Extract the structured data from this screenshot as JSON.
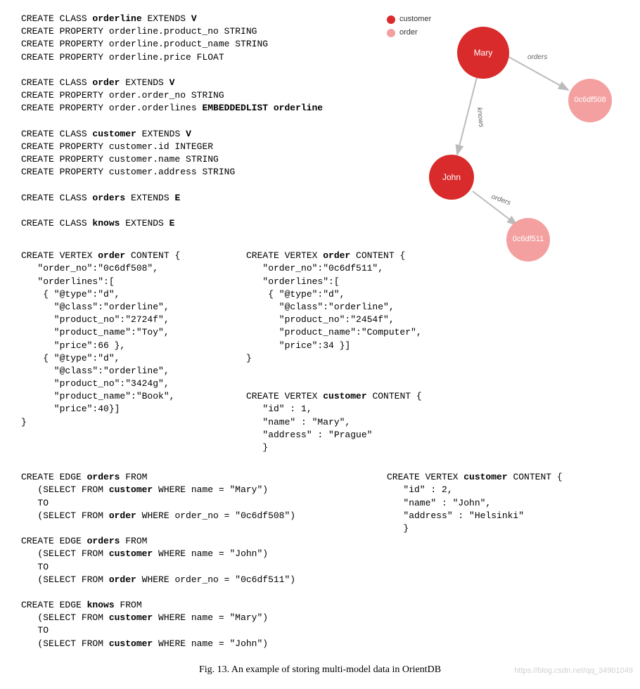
{
  "legend": {
    "customer": "customer",
    "order": "order"
  },
  "nodes": {
    "mary": "Mary",
    "john": "John",
    "o1": "0c6df508",
    "o2": "0c6df511"
  },
  "edges": {
    "orders": "orders",
    "knows": "knows"
  },
  "schema": {
    "l1a": "CREATE CLASS ",
    "l1b": "orderline",
    "l1c": " EXTENDS ",
    "l1d": "V",
    "l2": "CREATE PROPERTY orderline.product_no STRING",
    "l3": "CREATE PROPERTY orderline.product_name STRING",
    "l4": "CREATE PROPERTY orderline.price FLOAT",
    "l5a": "CREATE CLASS ",
    "l5b": "order",
    "l5c": " EXTENDS ",
    "l5d": "V",
    "l6": "CREATE PROPERTY order.order_no STRING",
    "l7a": "CREATE PROPERTY order.orderlines ",
    "l7b": "EMBEDDEDLIST orderline",
    "l8a": "CREATE CLASS ",
    "l8b": "customer",
    "l8c": " EXTENDS ",
    "l8d": "V",
    "l9": "CREATE PROPERTY customer.id INTEGER",
    "l10": "CREATE PROPERTY customer.name STRING",
    "l11": "CREATE PROPERTY customer.address STRING",
    "l12a": "CREATE CLASS ",
    "l12b": "orders",
    "l12c": " EXTENDS ",
    "l12d": "E",
    "l13a": "CREATE CLASS ",
    "l13b": "knows",
    "l13c": " EXTENDS ",
    "l13d": "E"
  },
  "vertex1": {
    "l1a": "CREATE VERTEX ",
    "l1b": "order",
    "l1c": " CONTENT {",
    "l2": "   \"order_no\":\"0c6df508\",",
    "l3": "   \"orderlines\":[",
    "l4": "    { \"@type\":\"d\",",
    "l5": "      \"@class\":\"orderline\",",
    "l6": "      \"product_no\":\"2724f\",",
    "l7": "      \"product_name\":\"Toy\",",
    "l8": "      \"price\":66 },",
    "l9": "    { \"@type\":\"d\",",
    "l10": "      \"@class\":\"orderline\",",
    "l11": "      \"product_no\":\"3424g\",",
    "l12": "      \"product_name\":\"Book\",",
    "l13": "      \"price\":40}]",
    "l14": "}"
  },
  "vertex2": {
    "l1a": "CREATE VERTEX ",
    "l1b": "order",
    "l1c": " CONTENT {",
    "l2": "   \"order_no\":\"0c6df511\",",
    "l3": "   \"orderlines\":[",
    "l4": "    { \"@type\":\"d\",",
    "l5": "      \"@class\":\"orderline\",",
    "l6": "      \"product_no\":\"2454f\",",
    "l7": "      \"product_name\":\"Computer\",",
    "l8": "      \"price\":34 }]",
    "l9": "}"
  },
  "cust1": {
    "l1a": "CREATE VERTEX ",
    "l1b": "customer",
    "l1c": " CONTENT {",
    "l2": "   \"id\" : 1,",
    "l3": "   \"name\" : \"Mary\",",
    "l4": "   \"address\" : \"Prague\"",
    "l5": "   }"
  },
  "cust2": {
    "l1a": "CREATE VERTEX ",
    "l1b": "customer",
    "l1c": " CONTENT {",
    "l2": "   \"id\" : 2,",
    "l3": "   \"name\" : \"John\",",
    "l4": "   \"address\" : \"Helsinki\"",
    "l5": "   }"
  },
  "edge1": {
    "l1a": "CREATE EDGE ",
    "l1b": "orders",
    "l1c": " FROM",
    "l2a": "   (SELECT FROM ",
    "l2b": "customer",
    "l2c": " WHERE name = \"Mary\")",
    "l3": "   TO",
    "l4a": "   (SELECT FROM ",
    "l4b": "order",
    "l4c": " WHERE order_no = \"0c6df508\")"
  },
  "edge2": {
    "l1a": "CREATE EDGE ",
    "l1b": "orders",
    "l1c": " FROM",
    "l2a": "   (SELECT FROM ",
    "l2b": "customer",
    "l2c": " WHERE name = \"John\")",
    "l3": "   TO",
    "l4a": "   (SELECT FROM ",
    "l4b": "order",
    "l4c": " WHERE order_no = \"0c6df511\")"
  },
  "edge3": {
    "l1a": "CREATE EDGE ",
    "l1b": "knows",
    "l1c": " FROM",
    "l2a": "   (SELECT FROM ",
    "l2b": "customer",
    "l2c": " WHERE name = \"Mary\")",
    "l3": "   TO",
    "l4a": "   (SELECT FROM ",
    "l4b": "customer",
    "l4c": " WHERE name = \"John\")"
  },
  "caption": "Fig. 13.   An example of storing multi-model data in OrientDB",
  "watermark": "https://blog.csdn.net/qq_34901049"
}
